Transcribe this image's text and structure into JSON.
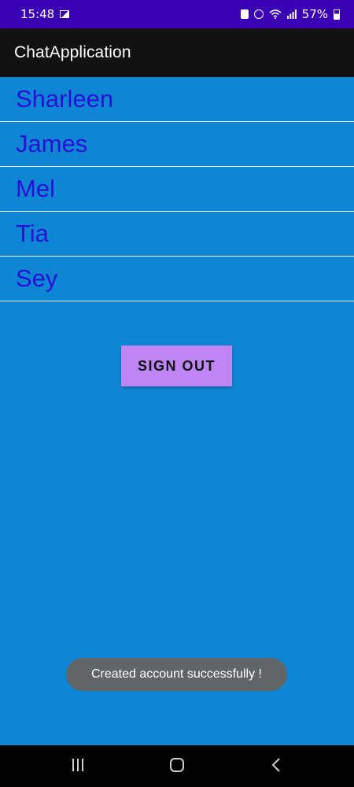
{
  "status_bar": {
    "time": "15:48",
    "battery_percent": "57%",
    "background_color": "#3A00B4"
  },
  "app_bar": {
    "title": "ChatApplication",
    "background_color": "#121212"
  },
  "users": [
    {
      "name": "Sharleen"
    },
    {
      "name": "James"
    },
    {
      "name": "Mel"
    },
    {
      "name": "Tia"
    },
    {
      "name": "Sey"
    }
  ],
  "sign_out": {
    "label": "SIGN OUT",
    "background_color": "#BE86F3"
  },
  "toast": {
    "message": "Created account successfully !"
  },
  "theme": {
    "background_color": "#0E86D4",
    "list_text_color": "#2A10D6"
  },
  "icons": {
    "status_left": [
      "image-icon"
    ],
    "status_right": [
      "lock-icon",
      "alarm-icon",
      "wifi-icon",
      "signal-icon",
      "battery-icon"
    ],
    "nav": [
      "recents-icon",
      "home-icon",
      "back-icon"
    ]
  }
}
